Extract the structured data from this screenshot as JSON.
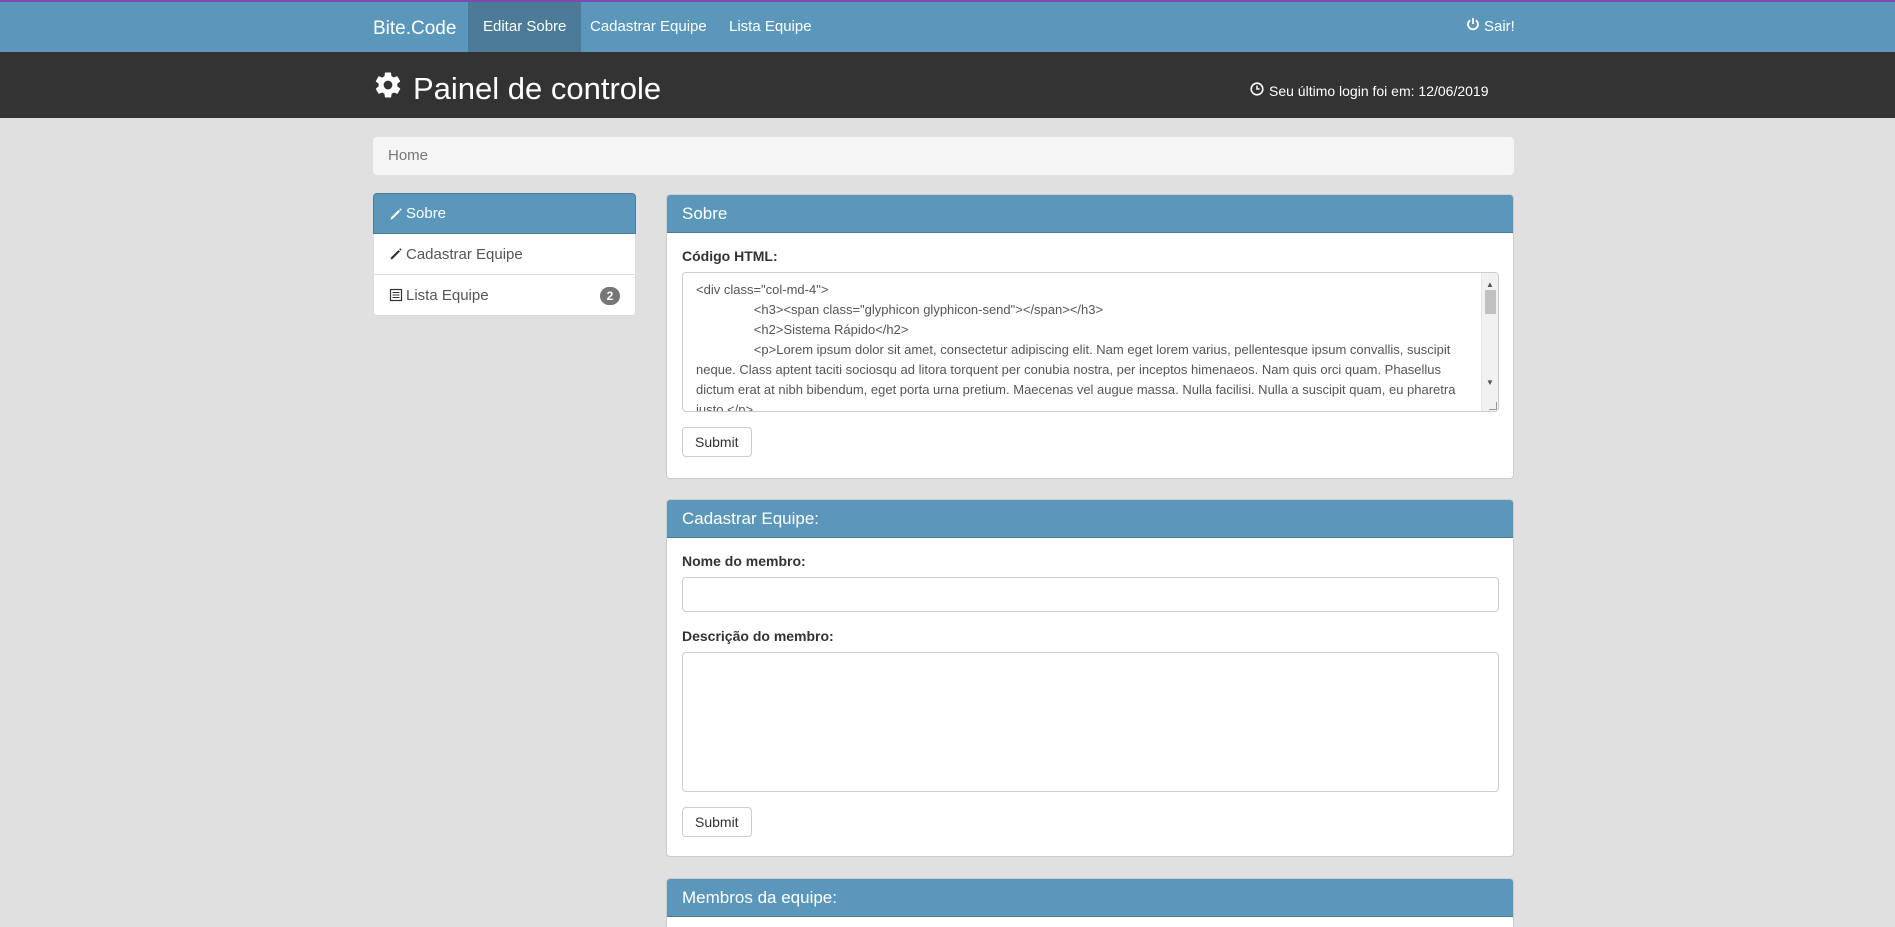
{
  "navbar": {
    "brand": "Bite.Code",
    "items": [
      {
        "label": "Editar Sobre",
        "active": true
      },
      {
        "label": "Cadastrar Equipe",
        "active": false
      },
      {
        "label": "Lista Equipe",
        "active": false
      }
    ],
    "logout_label": "Sair!"
  },
  "header": {
    "title": "Painel de controle",
    "last_login": "Seu último login foi em: 12/06/2019"
  },
  "breadcrumb": {
    "home": "Home"
  },
  "sidebar": {
    "items": [
      {
        "label": "Sobre",
        "icon": "pencil-icon",
        "active": true
      },
      {
        "label": "Cadastrar Equipe",
        "icon": "pencil-icon",
        "active": false
      },
      {
        "label": "Lista Equipe",
        "icon": "list-icon",
        "active": false,
        "badge": "2"
      }
    ]
  },
  "sobre_panel": {
    "title": "Sobre",
    "field_label": "Código HTML:",
    "code_lines": [
      "<div class=\"col-md-4\">",
      "                <h3><span class=\"glyphicon glyphicon-send\"></span></h3>",
      "                <h2>Sistema Rápido</h2>",
      "                <p>Lorem ipsum dolor sit amet, consectetur adipiscing elit. Nam eget lorem varius, pellentesque ipsum convallis, suscipit neque. Class aptent taciti sociosqu ad litora torquent per conubia nostra, per inceptos himenaeos. Nam quis orci quam. Phasellus dictum erat at nibh bibendum, eget porta urna pretium. Maecenas vel augue massa. Nulla facilisi. Nulla a suscipit quam, eu pharetra justo.</p>"
    ],
    "submit_label": "Submit"
  },
  "cadastrar_panel": {
    "title": "Cadastrar Equipe:",
    "name_label": "Nome do membro:",
    "name_value": "",
    "desc_label": "Descrição do membro:",
    "desc_value": "",
    "submit_label": "Submit"
  },
  "membros_panel": {
    "title": "Membros da equipe:"
  },
  "colors": {
    "primary": "#5a97bb",
    "primary_dark": "#4b7b97",
    "header_bg": "#333333",
    "page_bg": "#e0e0e0"
  }
}
